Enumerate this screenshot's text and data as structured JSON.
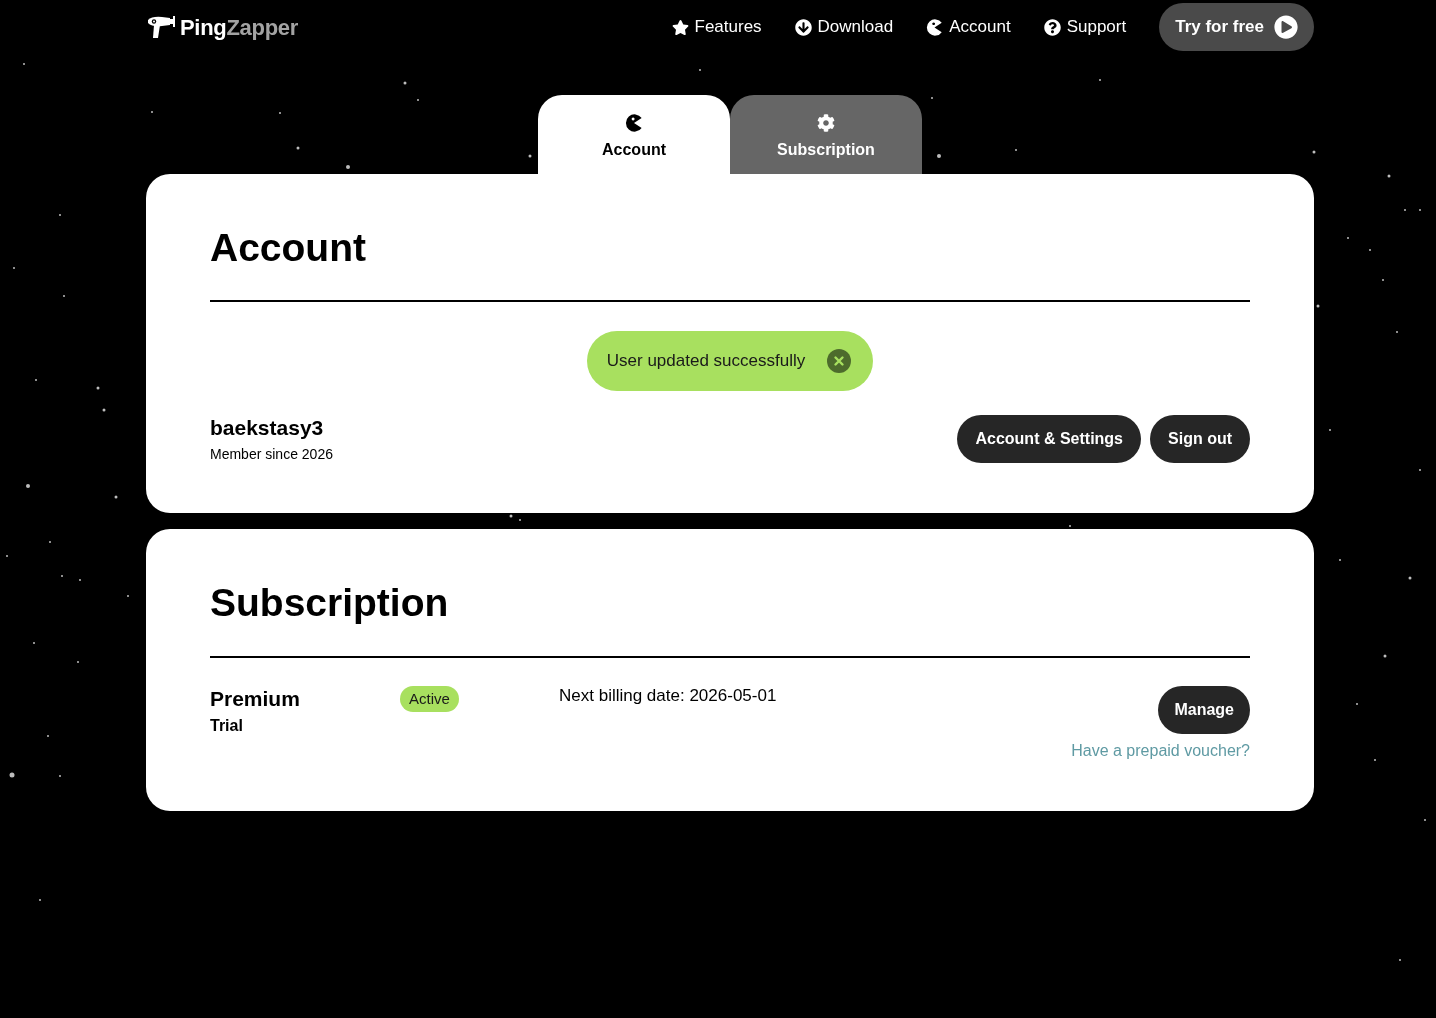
{
  "header": {
    "brand": [
      {
        "text": "Ping",
        "muted": false
      },
      {
        "text": "Zapper",
        "muted": true
      }
    ],
    "nav": [
      "Features",
      "Download",
      "Account",
      "Support"
    ],
    "cta": "Try for free"
  },
  "tabs": [
    {
      "label": "Account",
      "selected": true
    },
    {
      "label": "Subscription",
      "selected": false
    }
  ],
  "account": {
    "title": "Account",
    "toast": "User updated successfully",
    "username": "baekstasy3",
    "member_since": "Member since 2026",
    "buttons": [
      "Account & Settings",
      "Sign out"
    ]
  },
  "subscription": {
    "title": "Subscription",
    "plan": "Premium",
    "plan_type": "Trial",
    "status": "Active",
    "billing": "Next billing date: 2026-05-01",
    "manage": "Manage",
    "voucher_link": "Have a prepaid voucher?"
  }
}
